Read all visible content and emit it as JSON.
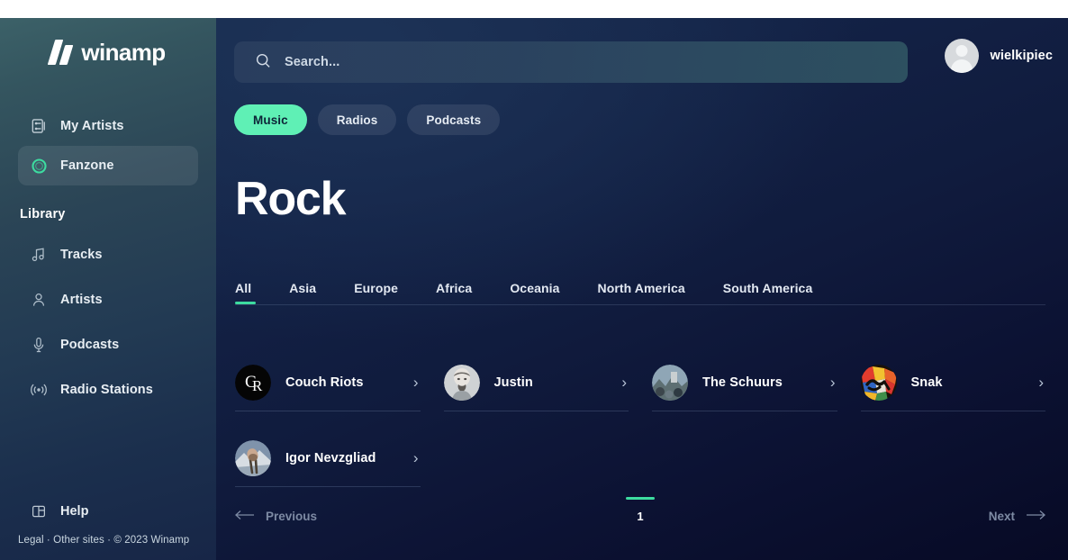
{
  "brand": {
    "name": "winamp",
    "logo_icon": "winamp-bolt-icon"
  },
  "sidebar": {
    "items": [
      {
        "label": "My Artists",
        "icon": "artists-cards-icon",
        "active": false
      },
      {
        "label": "Fanzone",
        "icon": "fanzone-ring-icon",
        "active": true
      }
    ],
    "section_label": "Library",
    "library_items": [
      {
        "label": "Tracks",
        "icon": "music-note-icon"
      },
      {
        "label": "Artists",
        "icon": "person-icon"
      },
      {
        "label": "Podcasts",
        "icon": "microphone-icon"
      },
      {
        "label": "Radio Stations",
        "icon": "broadcast-icon"
      }
    ],
    "help": {
      "label": "Help",
      "icon": "help-window-icon"
    },
    "legal": "Legal · Other sites · © 2023 Winamp",
    "legal_parts": {
      "legal": "Legal",
      "other_sites": "Other sites",
      "copyright": "© 2023 Winamp"
    }
  },
  "search": {
    "placeholder": "Search...",
    "value": "",
    "icon": "search-icon"
  },
  "profile": {
    "username": "wielkipiec",
    "avatar_icon": "default-user-avatar"
  },
  "pills": [
    {
      "label": "Music",
      "active": true
    },
    {
      "label": "Radios",
      "active": false
    },
    {
      "label": "Podcasts",
      "active": false
    }
  ],
  "page": {
    "title": "Rock"
  },
  "tabs": [
    {
      "label": "All",
      "active": true
    },
    {
      "label": "Asia",
      "active": false
    },
    {
      "label": "Europe",
      "active": false
    },
    {
      "label": "Africa",
      "active": false
    },
    {
      "label": "Oceania",
      "active": false
    },
    {
      "label": "North America",
      "active": false
    },
    {
      "label": "South America",
      "active": false
    }
  ],
  "artists": [
    {
      "name": "Couch Riots",
      "avatar": "cr-monogram-logo",
      "chevron": "chevron-right-icon"
    },
    {
      "name": "Justin",
      "avatar": "photo-bearded-man",
      "chevron": "chevron-right-icon"
    },
    {
      "name": "The Schuurs",
      "avatar": "photo-group-outdoors",
      "chevron": "chevron-right-icon"
    },
    {
      "name": "Snak",
      "avatar": "graffiti-snak-logo",
      "chevron": "chevron-right-icon"
    },
    {
      "name": "Igor Nevzgliad",
      "avatar": "photo-person-snow",
      "chevron": "chevron-right-icon"
    }
  ],
  "pagination": {
    "previous_label": "Previous",
    "next_label": "Next",
    "current_page": "1",
    "prev_icon": "arrow-left-icon",
    "next_icon": "arrow-right-icon"
  },
  "colors": {
    "accent_green": "#5ff0b5",
    "tab_underline": "#3ddca0",
    "sidebar_top": "#3c6168",
    "main_bg": "#0c1233"
  }
}
